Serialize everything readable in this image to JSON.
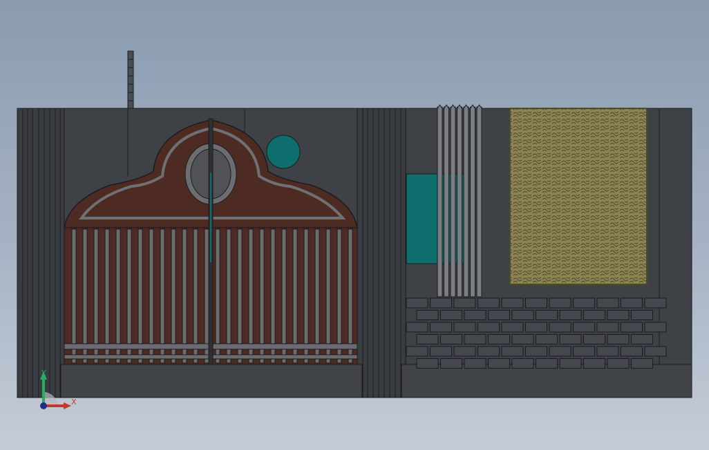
{
  "viewport": {
    "background_top": "#8a9bb0",
    "background_bottom": "#c5ccd7"
  },
  "triad": {
    "x_label": "X",
    "y_label": "Y",
    "x_color": "#c0392b",
    "y_color": "#27ae60",
    "origin_color": "#1f2d8c"
  },
  "model": {
    "wall_color": "#3e4146",
    "edge_color": "#1b1c1f",
    "gate_color": "#4e2b22",
    "accent_teal": "#0e6e6e",
    "grille_color": "#8c8252",
    "brick_color": "#44484e"
  }
}
